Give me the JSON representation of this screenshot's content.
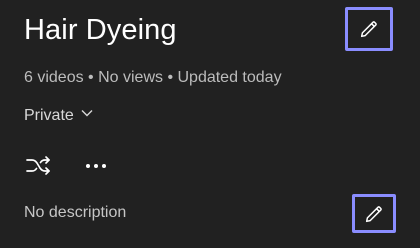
{
  "playlist": {
    "title": "Hair Dyeing",
    "meta": "6 videos • No views • Updated today",
    "privacy_label": "Private",
    "description": "No description"
  },
  "icons": {
    "edit_title": "pencil-icon",
    "privacy_dropdown": "chevron-down-icon",
    "shuffle": "shuffle-icon",
    "more": "more-horizontal-icon",
    "edit_description": "pencil-icon"
  },
  "colors": {
    "background": "#212121",
    "text_primary": "#ffffff",
    "text_secondary": "#bcbcbc",
    "highlight_border": "#8a8dff"
  }
}
